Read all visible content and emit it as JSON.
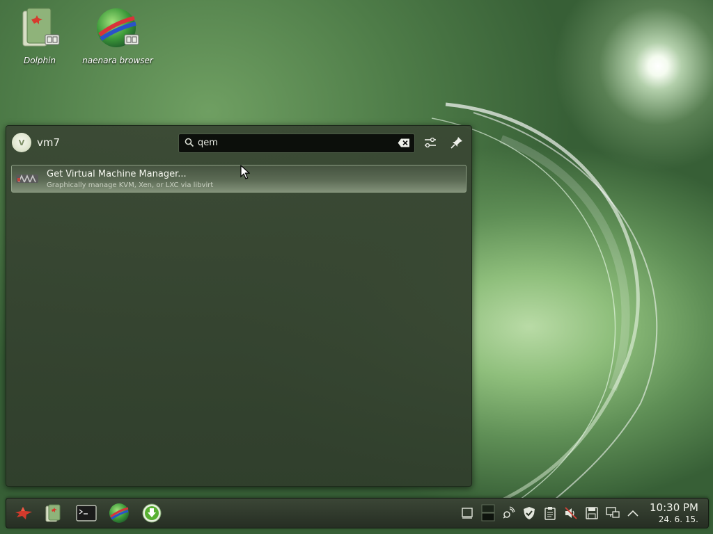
{
  "desktop": {
    "icons": [
      {
        "label": "Dolphin",
        "icon": "dolphin-file-manager-icon"
      },
      {
        "label": "naenara browser",
        "icon": "naenara-browser-globe-icon"
      }
    ]
  },
  "runner": {
    "user_name": "vm7",
    "avatar_initial": "V",
    "search": {
      "value": "qem",
      "placeholder": ""
    },
    "buttons": {
      "settings": "settings-sliders-icon",
      "pin": "pin-icon",
      "clear": "clear-text-icon"
    },
    "results": [
      {
        "title": "Get Virtual Machine Manager...",
        "subtitle": "Graphically manage KVM, Xen, or LXC via libvirt",
        "icon": "virt-manager-icon"
      }
    ]
  },
  "taskbar": {
    "launchers": [
      "application-menu-star-icon",
      "dolphin-file-manager-icon",
      "terminal-icon",
      "naenara-browser-globe-icon",
      "download-manager-icon"
    ],
    "tray": [
      "show-desktop-icon",
      "pager-icon",
      "network-icon",
      "security-shield-icon",
      "clipboard-icon",
      "volume-muted-icon",
      "save-disk-icon",
      "network-monitor-icon",
      "expand-tray-icon"
    ],
    "clock": {
      "time": "10:30 PM",
      "date": "24. 6. 15."
    }
  },
  "colors": {
    "accent_green": "#4e7c48",
    "panel_bg": "#3a4834",
    "highlight": "#8fa086"
  }
}
